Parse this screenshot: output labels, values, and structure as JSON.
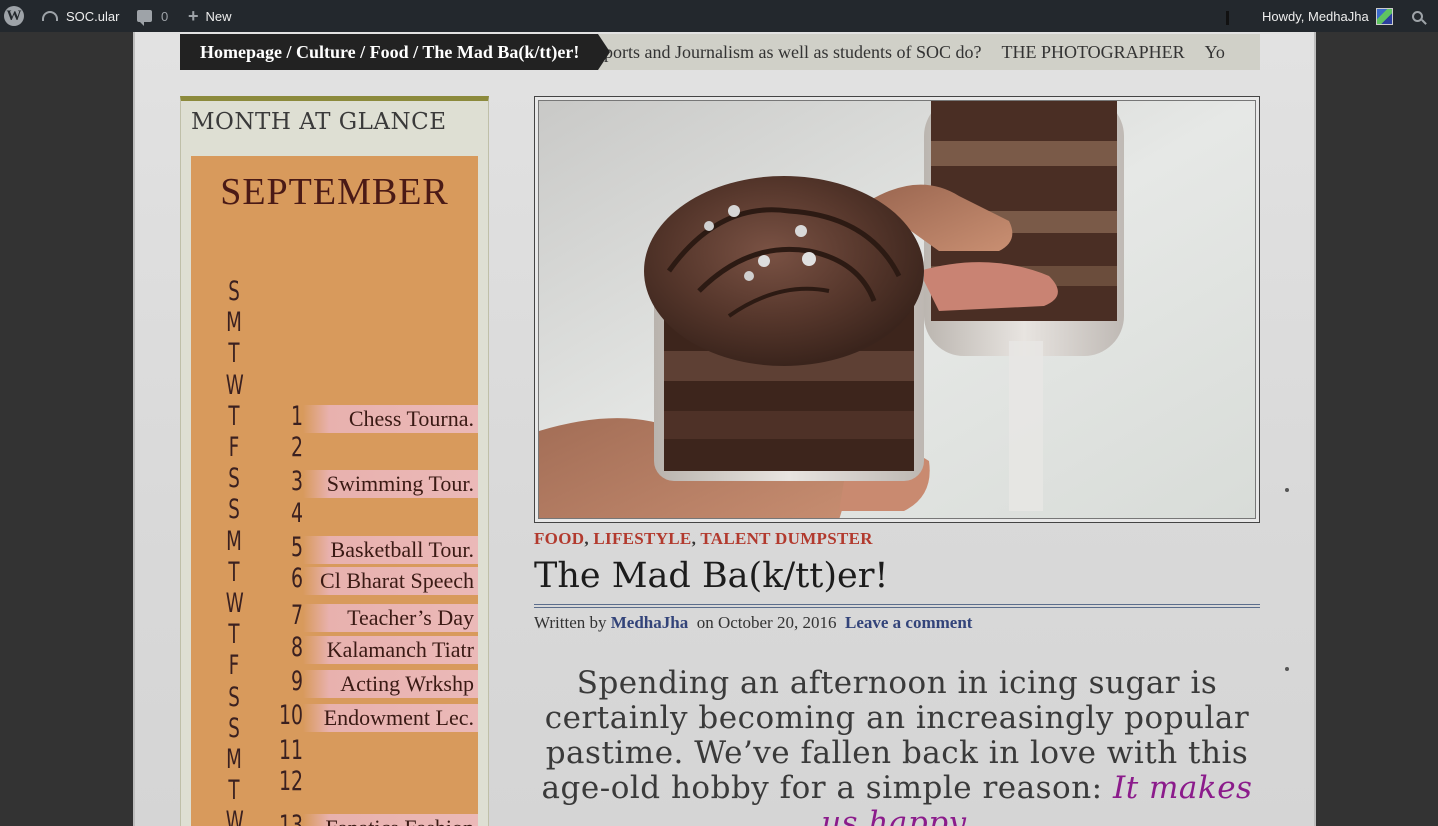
{
  "admin_bar": {
    "site_name": "SOC.ular",
    "comment_count": "0",
    "new_label": "New",
    "howdy": "Howdy, MedhaJha"
  },
  "ticker": {
    "breadcrumb": "Homepage / Culture / Food / The Mad Ba(k/tt)er!",
    "items": [
      "ports and Journalism as well as students of SOC do?",
      "THE PHOTOGRAPHER",
      "Yo"
    ]
  },
  "sidebar": {
    "widget_title": "MONTH AT GLANCE",
    "calendar": {
      "month": "SEPTEMBER",
      "weekday_letters": [
        "S",
        "M",
        "T",
        "W",
        "T",
        "F",
        "S",
        "S",
        "M",
        "T",
        "W",
        "T",
        "F",
        "S",
        "S",
        "M",
        "T",
        "W"
      ],
      "days": [
        {
          "num": "1",
          "event": "Chess Tourna."
        },
        {
          "num": "2",
          "event": ""
        },
        {
          "num": "3",
          "event": "Swimming Tour."
        },
        {
          "num": "4",
          "event": ""
        },
        {
          "num": "5",
          "event": "Basketball Tour."
        },
        {
          "num": "6",
          "event": "Cl Bharat Speech"
        },
        {
          "num": "7",
          "event": "Teacher’s Day"
        },
        {
          "num": "8",
          "event": "Kalamanch Tiatr"
        },
        {
          "num": "9",
          "event": "Acting Wrkshp"
        },
        {
          "num": "10",
          "event": "Endowment Lec."
        },
        {
          "num": "11",
          "event": ""
        },
        {
          "num": "12",
          "event": ""
        },
        {
          "num": "13",
          "event": "Fanatics Fashion"
        }
      ]
    }
  },
  "article": {
    "categories": [
      "FOOD",
      "LIFESTYLE",
      "TALENT DUMPSTER"
    ],
    "title": "The Mad Ba(k/tt)er!",
    "meta": {
      "written_by": "Written by",
      "author": "MedhaJha",
      "date": "on October 20, 2016",
      "comment_link": "Leave a comment"
    },
    "lede_plain": "Spending an afternoon in icing sugar is certainly becoming an increasingly popular pastime. We’ve fallen back in love with this age-old hobby for a simple reason:",
    "lede_highlight": "It makes us happy."
  },
  "icons": {
    "wordpress": "wordpress-logo-icon",
    "dashboard": "dashboard-icon",
    "comment": "comment-bubble-icon",
    "new": "plus-icon",
    "search": "search-icon"
  },
  "colors": {
    "admin_bar": "#23282d",
    "calendar_bg": "#d89a5c",
    "event_highlight": "#ebb9b8",
    "category": "#b23a2e",
    "highlight_text": "#8b1b8b",
    "widget_rule": "#8c8a3c"
  }
}
